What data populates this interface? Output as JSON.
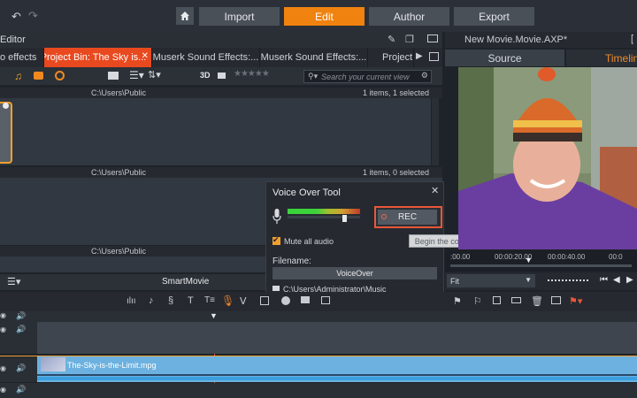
{
  "topbar": {
    "nav": [
      "Import",
      "Edit",
      "Author",
      "Export"
    ],
    "active": "Edit"
  },
  "editor": {
    "title": "Editor"
  },
  "tabs": [
    "o effects",
    "Project Bin: The Sky is...",
    "Muserk Sound Effects:...",
    "Muserk Sound Effects:...",
    "Project B"
  ],
  "library": {
    "toolbar_3d": "3D",
    "search_placeholder": "Search your current view",
    "bins": [
      {
        "path": "C:\\Users\\Public",
        "status": "1 items, 1 selected"
      },
      {
        "path": "C:\\Users\\Public",
        "status": "1 items, 0 selected"
      },
      {
        "path": "C:\\Users\\Public",
        "status": ""
      }
    ]
  },
  "voice_over": {
    "title": "Voice Over Tool",
    "rec_label": "REC",
    "tooltip": "Begin the countdown and start recording",
    "mute_label": "Mute all audio",
    "mute_checked": true,
    "filename_label": "Filename:",
    "filename_value": "VoiceOver",
    "folder_path": "C:\\Users\\Administrator\\Music"
  },
  "player": {
    "title": "New Movie.Movie.AXP*",
    "tab_source": "Source",
    "tab_timeline": "Timeline",
    "ruler_labels": [
      ":00.00",
      "00:00:20.00",
      "00:00:40.00",
      "00:0"
    ],
    "fit_label": "Fit"
  },
  "timeline": {
    "smartmovie_label": "SmartMovie",
    "clip_name": "The-Sky-is-the-Limit.mpg"
  },
  "colors": {
    "accent_orange": "#f0820f",
    "active_tab": "#e9491f",
    "clip_blue": "#6cb1df"
  }
}
